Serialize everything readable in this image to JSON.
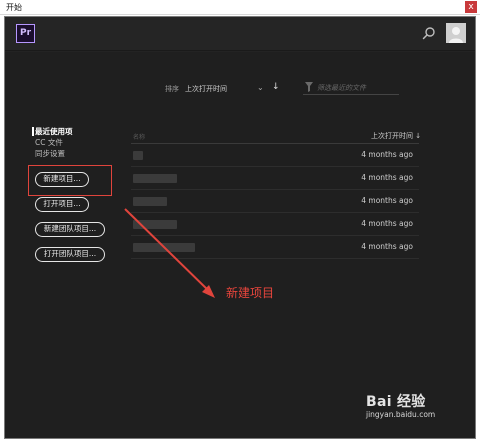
{
  "window": {
    "title": "开始",
    "close_glyph": "x"
  },
  "header": {
    "logo_text": "Pr"
  },
  "toolbar": {
    "sort_label": "排序",
    "sort_value": "上次打开时间",
    "sort_chevron": "⌄",
    "sort_direction": "↓",
    "filter_placeholder": "筛选最近的文件"
  },
  "nav": {
    "items": [
      {
        "label": "最近使用项",
        "active": true
      },
      {
        "label": "CC 文件",
        "active": false
      },
      {
        "label": "同步设置",
        "active": false
      }
    ]
  },
  "buttons": {
    "new_project": "新建项目...",
    "open_project": "打开项目...",
    "new_team_project": "新建团队项目...",
    "open_team_project": "打开团队项目..."
  },
  "table": {
    "headers": {
      "name": "名称",
      "last_opened": "上次打开时间 ↓"
    },
    "rows": [
      {
        "last_opened": "4 months ago"
      },
      {
        "last_opened": "4 months ago"
      },
      {
        "last_opened": "4 months ago"
      },
      {
        "last_opened": "4 months ago"
      },
      {
        "last_opened": "4 months ago"
      }
    ]
  },
  "annotation": {
    "text": "新建项目",
    "color": "#e8453c"
  },
  "watermark": {
    "logo": "Bai 经验",
    "url": "jingyan.baidu.com"
  },
  "colors": {
    "accent_purple": "#b697ff",
    "highlight_red": "#e0443c"
  }
}
